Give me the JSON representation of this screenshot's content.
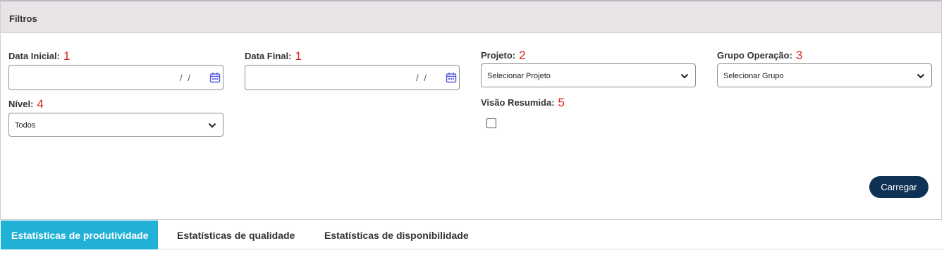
{
  "panel": {
    "title": "Filtros"
  },
  "fields": {
    "data_inicial": {
      "label": "Data Inicial:",
      "marker": "1",
      "mask": "/ /"
    },
    "data_final": {
      "label": "Data Final:",
      "marker": "1",
      "mask": "/ /"
    },
    "projeto": {
      "label": "Projeto:",
      "marker": "2",
      "selected": "Selecionar Projeto"
    },
    "grupo_operacao": {
      "label": "Grupo Operação:",
      "marker": "3",
      "selected": "Selecionar Grupo"
    },
    "nivel": {
      "label": "Nível:",
      "marker": "4",
      "selected": "Todos"
    },
    "visao_resumida": {
      "label": "Visão Resumida:",
      "marker": "5",
      "checked": false
    }
  },
  "actions": {
    "carregar_label": "Carregar"
  },
  "tabs": [
    {
      "label": "Estatísticas de produtividade",
      "active": true
    },
    {
      "label": "Estatísticas de qualidade",
      "active": false
    },
    {
      "label": "Estatísticas de disponibilidade",
      "active": false
    }
  ],
  "colors": {
    "header_bg": "#e7e3e7",
    "button_bg": "#0e3155",
    "active_tab_bg": "#22b1d6",
    "marker_red": "#e0201d",
    "calendar_icon": "#5b5ee0"
  },
  "icons": {
    "calendar": "calendar-icon",
    "dropdown": "chevron-down-icon"
  }
}
